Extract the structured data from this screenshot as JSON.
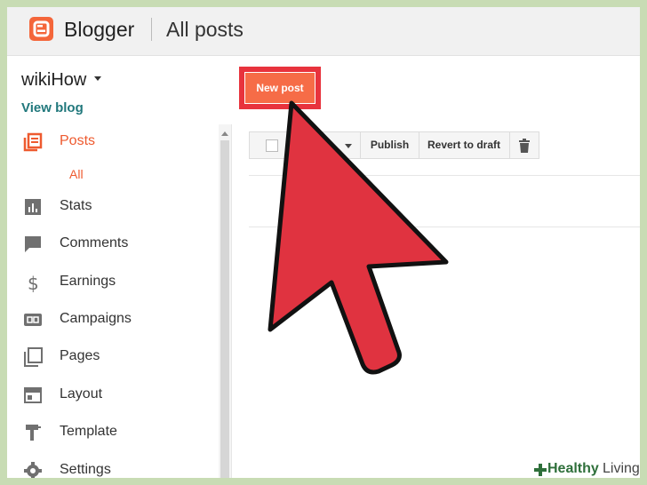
{
  "header": {
    "app_name": "Blogger",
    "page_title": "All posts"
  },
  "sidebar": {
    "blog_name": "wikiHow",
    "view_blog": "View blog",
    "items": [
      {
        "label": "Posts",
        "icon": "posts-icon",
        "active": true
      },
      {
        "label": "Stats",
        "icon": "stats-icon"
      },
      {
        "label": "Comments",
        "icon": "comments-icon"
      },
      {
        "label": "Earnings",
        "icon": "dollar-icon"
      },
      {
        "label": "Campaigns",
        "icon": "ad-icon"
      },
      {
        "label": "Pages",
        "icon": "pages-icon"
      },
      {
        "label": "Layout",
        "icon": "layout-icon"
      },
      {
        "label": "Template",
        "icon": "template-icon"
      },
      {
        "label": "Settings",
        "icon": "gear-icon"
      }
    ],
    "sub_item": "All"
  },
  "main": {
    "new_post_label": "New post",
    "toolbar": {
      "publish_label": "Publish",
      "revert_label": "Revert to draft"
    }
  },
  "watermark": {
    "brand_part1": "Healthy",
    "brand_part2": "Living"
  },
  "colors": {
    "accent": "#f4663a",
    "highlight": "#e8333d",
    "link": "#21787c",
    "arrow": "#e03340"
  }
}
